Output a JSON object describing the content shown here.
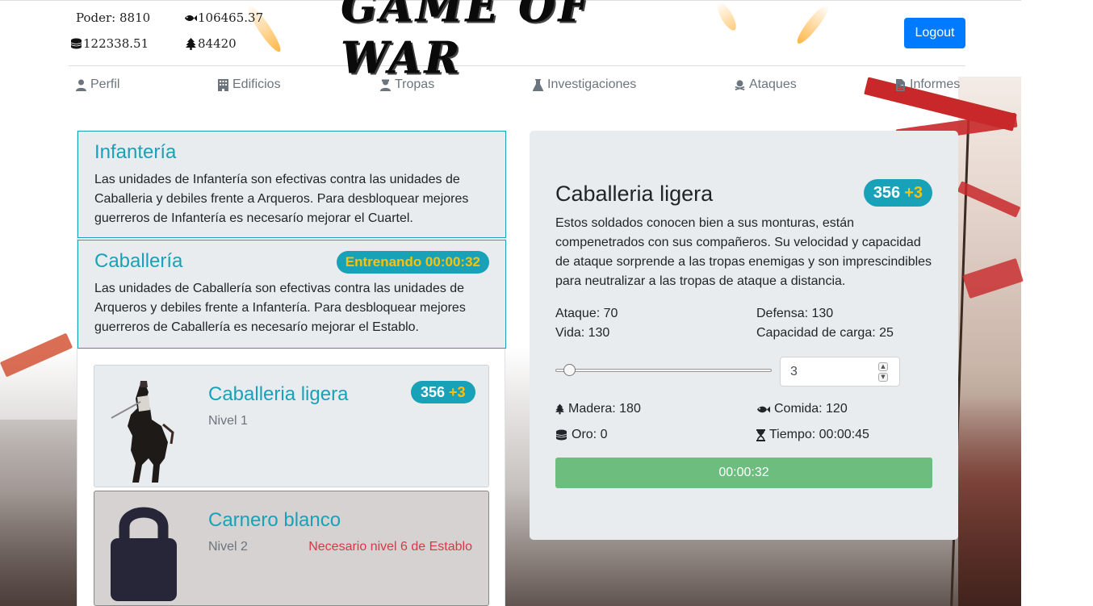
{
  "resources": {
    "power": "Poder: 8810",
    "food": "106465.37",
    "gold": "122338.51",
    "wood": "84420"
  },
  "logo_text": "GAME OF WAR",
  "logout_label": "Logout",
  "nav": [
    {
      "label": "Perfil",
      "icon": "user-icon"
    },
    {
      "label": "Edificios",
      "icon": "building-icon"
    },
    {
      "label": "Tropas",
      "icon": "troops-icon"
    },
    {
      "label": "Investigaciones",
      "icon": "flask-icon"
    },
    {
      "label": "Ataques",
      "icon": "skull-crossbones-icon"
    },
    {
      "label": "Informes",
      "icon": "file-icon"
    }
  ],
  "categories": [
    {
      "title": "Infantería",
      "description": "Las unidades de Infantería son efectivas contra las unidades de Caballeria y debiles frente a Arqueros. Para desbloquear mejores guerreros de Infantería es necesarío mejorar el Cuartel."
    },
    {
      "title": "Caballería",
      "badge": "Entrenando 00:00:32",
      "description": "Las unidades de Caballería son efectivas contra las unidades de Arqueros y debiles frente a Infantería. Para desbloquear mejores guerreros de Caballería es necesarío mejorar el Establo."
    }
  ],
  "units": [
    {
      "name": "Caballeria ligera",
      "level": "Nivel 1",
      "count": "356",
      "plus": "+3"
    },
    {
      "name": "Carnero blanco",
      "level": "Nivel 2",
      "requirement": "Necesario nivel 6 de Establo"
    }
  ],
  "detail": {
    "title": "Caballeria ligera",
    "count": "356",
    "plus": "+3",
    "description": "Estos soldados conocen bien a sus monturas, están compenetrados con sus compañeros. Su velocidad y capacidad de ataque sorprende a las tropas enemigas y son imprescindibles para neutralizar a las tropas de ataque a distancia.",
    "attack": "Ataque: 70",
    "defense": "Defensa: 130",
    "life": "Vida: 130",
    "capacity": "Capacidad de carga: 25",
    "slider_fraction": 0.04,
    "quantity": "3",
    "cost_wood": "Madera: 180",
    "cost_food": "Comida: 120",
    "cost_gold": "Oro: 0",
    "cost_time": "Tiempo: 00:00:45",
    "button_label": "00:00:32"
  },
  "colors": {
    "primary": "#007bff",
    "info": "#17a2b8",
    "warning": "#ffc107",
    "danger": "#dc3545",
    "success_button": "#6cbd7e",
    "panel": "#e9ecef"
  }
}
